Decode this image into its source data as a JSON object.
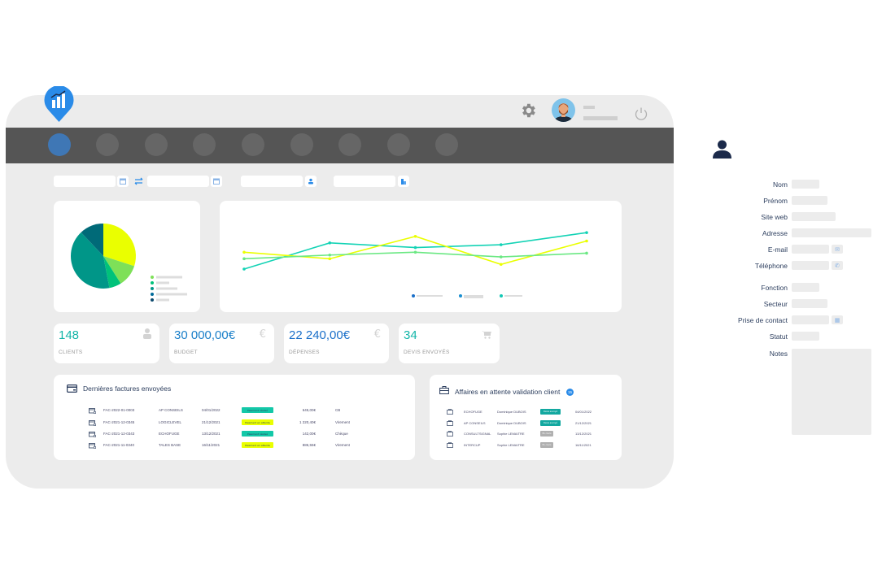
{
  "header": {
    "logo_icon": "bar-chart-pin-icon",
    "settings_icon": "gear-icon",
    "avatar_icon": "user-avatar",
    "power_icon": "power-icon"
  },
  "nav": {
    "item_count": 9,
    "active_index": 0
  },
  "filters": {
    "date_from": "",
    "date_to": "",
    "user": "",
    "category": "",
    "icons": [
      "calendar-icon",
      "swap-arrows-icon",
      "calendar-icon",
      "person-icon",
      "building-icon"
    ]
  },
  "colors": {
    "accent_blue": "#2a8be8",
    "teal": "#13c8b5",
    "yellow": "#eaff00",
    "light_green": "#7ee058",
    "navbar": "#555555",
    "background": "#ececec"
  },
  "chart_data": [
    {
      "type": "pie",
      "title": "",
      "categories": [
        "",
        "",
        "",
        "",
        ""
      ],
      "values": [
        30,
        11,
        6,
        41,
        12
      ],
      "colors": [
        "#eaff00",
        "#7ee058",
        "#00c27a",
        "#009688",
        "#006a78"
      ],
      "legend_colors": [
        "#7ee058",
        "#00c27a",
        "#009688",
        "#006a9a",
        "#0d4a6e"
      ],
      "legend": "bottom-right"
    },
    {
      "type": "line",
      "title": "",
      "x": [
        1,
        2,
        3,
        4,
        5
      ],
      "ylim": [
        0,
        10
      ],
      "series": [
        {
          "name": "",
          "color": "#13d3b5",
          "values": [
            4.0,
            6.8,
            6.3,
            6.6,
            7.9
          ]
        },
        {
          "name": "",
          "color": "#eaff00",
          "values": [
            5.8,
            5.1,
            7.5,
            4.5,
            7.0
          ]
        },
        {
          "name": "",
          "color": "#6be883",
          "values": [
            5.1,
            5.5,
            5.8,
            5.3,
            5.7
          ]
        }
      ],
      "legend_colors": [
        "#1a6fc9",
        "#1a8fd0",
        "#13c8b5"
      ],
      "legend": "bottom-right",
      "grid": false
    }
  ],
  "kpis": [
    {
      "value": "148",
      "label": "CLIENTS",
      "icon": "person-icon",
      "color": "#13b5a8"
    },
    {
      "value": "30 000,00€",
      "label": "BUDGET",
      "icon": "euro-icon",
      "color": "#1a7fc9"
    },
    {
      "value": "22 240,00€",
      "label": "DÉPENSES",
      "icon": "euro-icon",
      "color": "#1a6fc9"
    },
    {
      "value": "34",
      "label": "DEVIS ENVOYÉS",
      "icon": "cart-icon",
      "color": "#13b5a8"
    }
  ],
  "invoices": {
    "title": "Dernières factures envoyées",
    "rows": [
      {
        "ref": "FAC-2022-01-0003",
        "client": "AP CONSEILS",
        "date": "04/01/2022",
        "status": "Paiement réalisé",
        "status_color": "#13c8a8",
        "amount": "645,00€",
        "method": "CB"
      },
      {
        "ref": "FAC-2021-12-0345",
        "client": "LOGICLEVEL",
        "date": "21/12/2021",
        "status": "Paiement en attente",
        "status_color": "#eaff00",
        "amount": "1 220,40€",
        "method": "Virement"
      },
      {
        "ref": "FAC-2021-12-0343",
        "client": "ECHOFUGE",
        "date": "13/12/2021",
        "status": "Paiement réalisé",
        "status_color": "#13c8a8",
        "amount": "142,00€",
        "method": "Chèque"
      },
      {
        "ref": "FAC-2021-11-0340",
        "client": "TALES BASE",
        "date": "16/11/2021",
        "status": "Paiement en attente",
        "status_color": "#eaff00",
        "amount": "886,55€",
        "method": "Virement"
      }
    ]
  },
  "deals": {
    "title": "Affaires en attente validation client",
    "count": "15",
    "rows": [
      {
        "company": "ECHOFUGE",
        "contact": "Dominique DUBOIS",
        "status": "Devis envoyé",
        "status_color": "#13a8a0",
        "date": "04/01/2022"
      },
      {
        "company": "AP CONSEILS",
        "contact": "Dominique DUBOIS",
        "status": "Devis envoyé",
        "status_color": "#13a8a0",
        "date": "21/12/2021"
      },
      {
        "company": "CONSULTSIGNAL",
        "contact": "Sophie LEMAITRE",
        "status": "En cours",
        "status_color": "#b0b0b0",
        "date": "13/12/2021"
      },
      {
        "company": "INTERCUP",
        "contact": "Sophie LEMAITRE",
        "status": "En cours",
        "status_color": "#b0b0b0",
        "date": "16/11/2021"
      }
    ]
  },
  "contact_panel": {
    "icon": "person-icon",
    "fields": [
      {
        "label": "Nom",
        "value": ""
      },
      {
        "label": "Prénom",
        "value": ""
      },
      {
        "label": "Site web",
        "value": ""
      },
      {
        "label": "Adresse",
        "value": ""
      },
      {
        "label": "E-mail",
        "value": "",
        "icon": "mail-icon"
      },
      {
        "label": "Téléphone",
        "value": "",
        "icon": "phone-icon"
      },
      {
        "label": "Fonction",
        "value": ""
      },
      {
        "label": "Secteur",
        "value": ""
      },
      {
        "label": "Prise de contact",
        "value": "",
        "icon": "calendar-icon"
      },
      {
        "label": "Statut",
        "value": ""
      },
      {
        "label": "Notes",
        "value": ""
      }
    ]
  }
}
